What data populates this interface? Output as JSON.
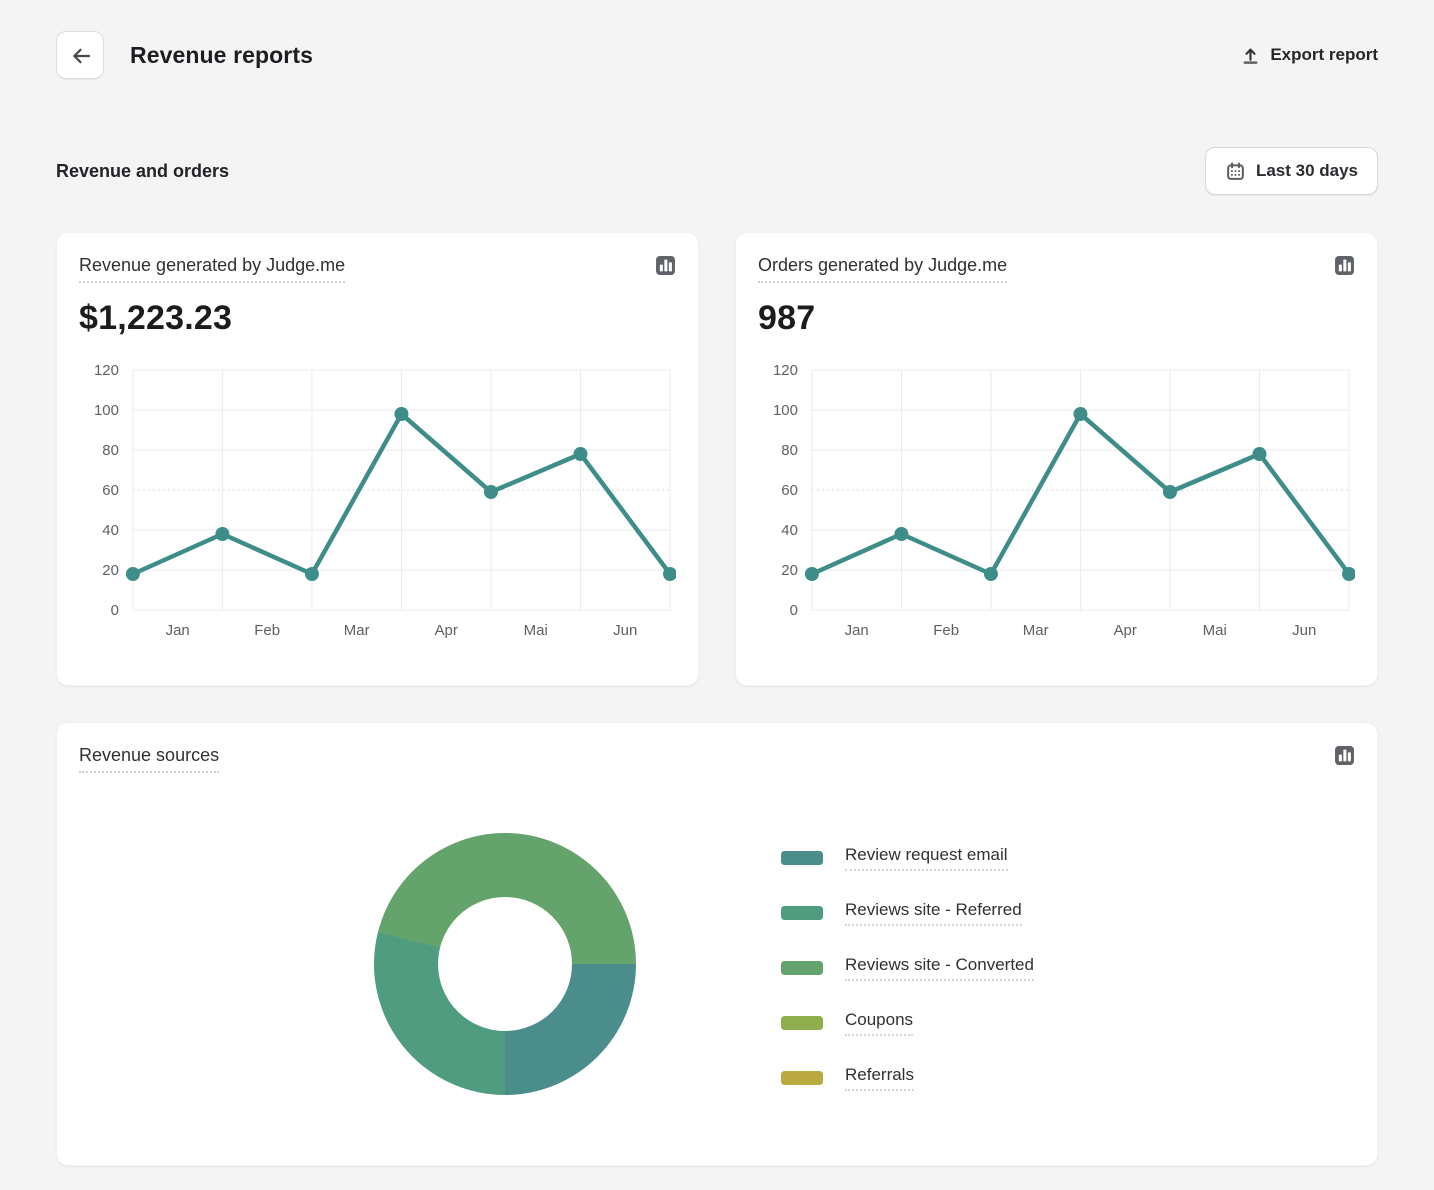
{
  "header": {
    "title": "Revenue reports",
    "export_label": "Export report"
  },
  "toolbar": {
    "section_title": "Revenue and orders",
    "date_range_label": "Last 30 days"
  },
  "cards": {
    "revenue": {
      "title": "Revenue generated by Judge.me",
      "value": "$1,223.23"
    },
    "orders": {
      "title": "Orders generated by Judge.me",
      "value": "987"
    },
    "sources": {
      "title": "Revenue sources"
    }
  },
  "icons": {
    "back": "arrow-left-icon",
    "export": "upload-icon",
    "date_range": "calendar-icon",
    "card_corner": "bar-chart-icon"
  },
  "colors": {
    "page_bg": "#f4f4f5",
    "card_bg": "#ffffff",
    "line": "#3f8d89",
    "grid": "#ebebec",
    "grid_dotted": "#d8d8d9",
    "tick_text": "#5d6064"
  },
  "chart_data": [
    {
      "type": "line",
      "title": "Revenue generated by Judge.me",
      "total_label": "$1,223.23",
      "x_tick_labels": [
        "Jan",
        "Feb",
        "Mar",
        "Apr",
        "Mai",
        "Jun"
      ],
      "x_note": "7 data points sit on the 7 vertical gridlines; month labels are centered between gridlines",
      "values": [
        18,
        38,
        18,
        98,
        59,
        78,
        18
      ],
      "y_ticks": [
        0,
        20,
        40,
        60,
        80,
        100,
        120
      ],
      "ylim": [
        0,
        120
      ],
      "dotted_gridline_at": 60,
      "line_color": "#3f8d89",
      "marker": "circle",
      "grid": true,
      "legend": false
    },
    {
      "type": "line",
      "title": "Orders generated by Judge.me",
      "total_label": "987",
      "x_tick_labels": [
        "Jan",
        "Feb",
        "Mar",
        "Apr",
        "Mai",
        "Jun"
      ],
      "x_note": "7 data points sit on the 7 vertical gridlines; month labels are centered between gridlines",
      "values": [
        18,
        38,
        18,
        98,
        59,
        78,
        18
      ],
      "y_ticks": [
        0,
        20,
        40,
        60,
        80,
        100,
        120
      ],
      "ylim": [
        0,
        120
      ],
      "dotted_gridline_at": 60,
      "line_color": "#3f8d89",
      "marker": "circle",
      "grid": true,
      "legend": false
    },
    {
      "type": "pie",
      "donut": true,
      "title": "Revenue sources",
      "start": "3 o'clock, clockwise",
      "segments": [
        {
          "label": "Review request email",
          "color": "#4a8d8b",
          "pct": 25.0
        },
        {
          "label": "Reviews site - Referred",
          "color": "#4f9c7e",
          "pct": 28.9
        },
        {
          "label": "Reviews site - Converted",
          "color": "#64a46c",
          "pct": 46.1
        },
        {
          "label": "Coupons",
          "color": "#8fae4d",
          "pct": 0
        },
        {
          "label": "Referrals",
          "color": "#b9a93f",
          "pct": 0
        }
      ],
      "legend_position": "right"
    }
  ]
}
